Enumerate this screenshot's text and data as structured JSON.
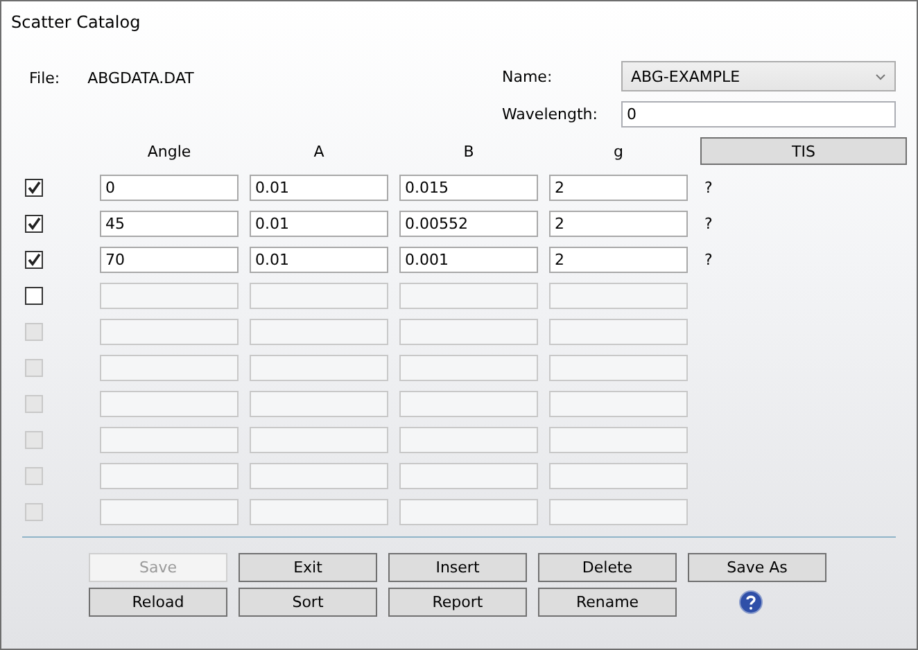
{
  "window": {
    "title": "Scatter Catalog"
  },
  "file": {
    "label": "File:",
    "value": "ABGDATA.DAT"
  },
  "name": {
    "label": "Name:",
    "value": "ABG-EXAMPLE"
  },
  "wavelength": {
    "label": "Wavelength:",
    "value": "0"
  },
  "tis_button": "TIS",
  "columns": [
    "Angle",
    "A",
    "B",
    "g"
  ],
  "rows": [
    {
      "checked": true,
      "disabled": false,
      "values": [
        "0",
        "0.01",
        "0.015",
        "2"
      ],
      "note": "?"
    },
    {
      "checked": true,
      "disabled": false,
      "values": [
        "45",
        "0.01",
        "0.00552",
        "2"
      ],
      "note": "?"
    },
    {
      "checked": true,
      "disabled": false,
      "values": [
        "70",
        "0.01",
        "0.001",
        "2"
      ],
      "note": "?"
    },
    {
      "checked": false,
      "disabled": false
    },
    {
      "checked": false,
      "disabled": true
    },
    {
      "checked": false,
      "disabled": true
    },
    {
      "checked": false,
      "disabled": true
    },
    {
      "checked": false,
      "disabled": true
    },
    {
      "checked": false,
      "disabled": true
    },
    {
      "checked": false,
      "disabled": true
    }
  ],
  "buttons": [
    {
      "label": "Save",
      "disabled": true
    },
    {
      "label": "Exit",
      "disabled": false
    },
    {
      "label": "Insert",
      "disabled": false
    },
    {
      "label": "Delete",
      "disabled": false
    },
    {
      "label": "Save As",
      "disabled": false
    },
    {
      "label": "Reload",
      "disabled": false
    },
    {
      "label": "Sort",
      "disabled": false
    },
    {
      "label": "Report",
      "disabled": false
    },
    {
      "label": "Rename",
      "disabled": false
    }
  ]
}
